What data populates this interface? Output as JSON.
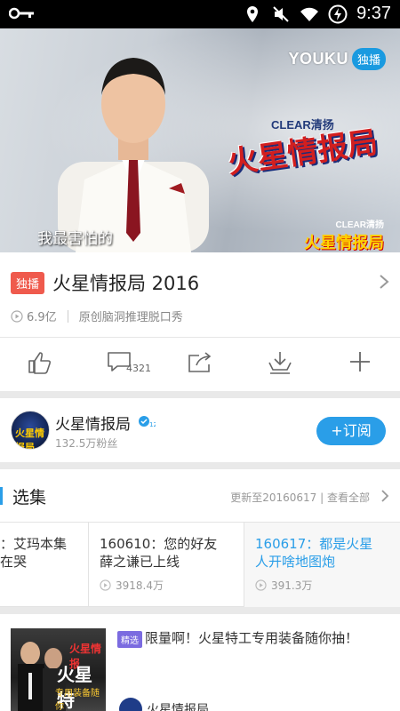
{
  "status_bar": {
    "time": "9:37"
  },
  "video": {
    "brand": "YOUKU",
    "brand_tag": "独播",
    "logo_brand": "CLEAR清扬",
    "logo_title": "火星情报局",
    "subtitle": "我最害怕的"
  },
  "show": {
    "badge": "独播",
    "title": "火星情报局 2016",
    "views": "6.9亿",
    "tagline": "原创脑洞推理脱口秀"
  },
  "actions": {
    "comment_count": "4321"
  },
  "channel": {
    "name": "火星情报局",
    "fans": "132.5万粉丝",
    "subscribe_label": "+订阅"
  },
  "episodes": {
    "section_title": "选集",
    "update_info": "更新至20160617 | 查看全部",
    "items": [
      {
        "text": "：艾玛本集\n在哭",
        "views": "万",
        "active": false
      },
      {
        "text": "160610：您的好友\n薛之谦已上线",
        "views": "3918.4万",
        "active": false
      },
      {
        "text": "160617：都是火星\n人开啥地图炮",
        "views": "391.3万",
        "active": true
      }
    ]
  },
  "recommendation": {
    "tag": "精选",
    "title": "限量啊！火星特工专用装备随你抽！",
    "author": "火星情报局",
    "thumb_logo": "火星情报",
    "thumb_title": "火星特",
    "thumb_sub": "专用装备随你"
  },
  "colors": {
    "accent": "#2a9ee8",
    "exclusive_badge": "#ef5a4d",
    "pick_badge": "#7b6be0"
  }
}
